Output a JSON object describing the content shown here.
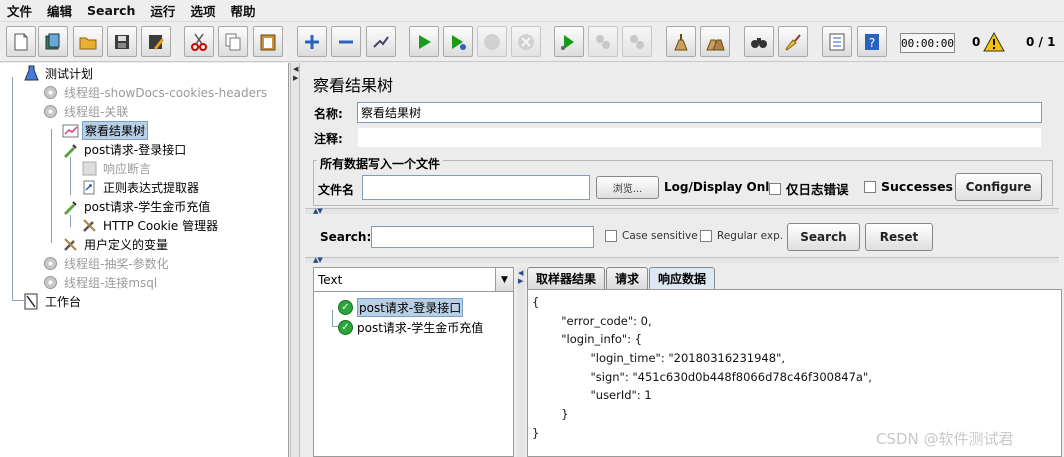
{
  "menu": [
    "文件",
    "编辑",
    "Search",
    "运行",
    "选项",
    "帮助"
  ],
  "toolbar": {
    "timer": "00:00:00",
    "error_count": "0",
    "threads": "0 / 1"
  },
  "tree": {
    "root": "测试计划",
    "items": [
      {
        "label": "线程组-showDocs-cookies-headers",
        "enabled": false
      },
      {
        "label": "线程组-关联",
        "enabled": false
      },
      {
        "label": "察看结果树",
        "selected": true
      },
      {
        "label": "post请求-登录接口"
      },
      {
        "label": "响应断言",
        "enabled": false
      },
      {
        "label": "正则表达式提取器"
      },
      {
        "label": "post请求-学生金币充值"
      },
      {
        "label": "HTTP Cookie 管理器"
      },
      {
        "label": "用户定义的变量"
      },
      {
        "label": "线程组-抽奖-参数化",
        "enabled": false
      },
      {
        "label": "线程组-连接msql",
        "enabled": false
      }
    ],
    "workbench": "工作台"
  },
  "panel": {
    "title": "察看结果树",
    "name_label": "名称:",
    "name_value": "察看结果树",
    "comment_label": "注释:",
    "section_title": "所有数据写入一个文件",
    "filename_label": "文件名",
    "browse_label": "浏览...",
    "log_display_label": "Log/Display Only:",
    "errors_only_label": "仅日志错误",
    "successes_label": "Successes",
    "configure_label": "Configure"
  },
  "search": {
    "label": "Search:",
    "case_sensitive": "Case sensitive",
    "regexp": "Regular exp.",
    "search_button": "Search",
    "reset_button": "Reset"
  },
  "results": {
    "renderer": "Text",
    "items": [
      "post请求-登录接口",
      "post请求-学生金币充值"
    ],
    "tabs": [
      "取样器结果",
      "请求",
      "响应数据"
    ],
    "active_tab": 2,
    "response_lines": [
      "{",
      "        \"error_code\": 0,",
      "        \"login_info\": {",
      "                \"login_time\": \"20180316231948\",",
      "                \"sign\": \"451c630d0b448f8066d78c46f300847a\",",
      "                \"userId\": 1",
      "        }",
      "}"
    ]
  },
  "watermark": "CSDN @软件测试君"
}
